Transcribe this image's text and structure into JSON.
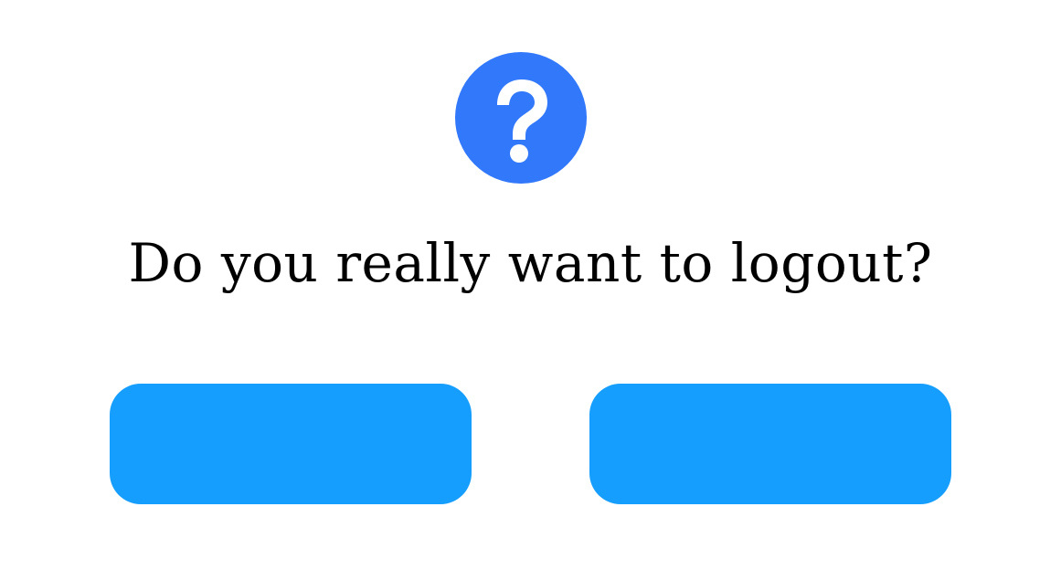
{
  "dialog": {
    "icon": "question-circle-icon",
    "message": "Do you really want to logout?",
    "buttons": [
      {
        "label": ""
      },
      {
        "label": ""
      }
    ]
  },
  "colors": {
    "background": "#ffffff",
    "icon_fill": "#3278fb",
    "icon_glyph": "#ffffff",
    "button_fill": "#169efe",
    "text": "#000000"
  }
}
